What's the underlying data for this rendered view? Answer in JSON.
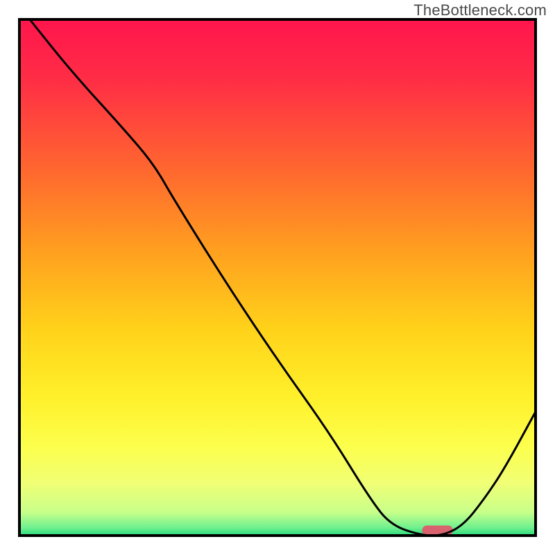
{
  "watermark": "TheBottleneck.com",
  "chart_data": {
    "type": "line",
    "title": "",
    "xlabel": "",
    "ylabel": "",
    "xlim": [
      0,
      100
    ],
    "ylim": [
      0,
      100
    ],
    "x": [
      2,
      10,
      20,
      26,
      30,
      40,
      50,
      60,
      68,
      72,
      78,
      82,
      86,
      90,
      94,
      100
    ],
    "y": [
      100,
      90,
      79,
      72,
      65,
      49,
      34,
      20,
      7,
      2,
      0,
      0,
      2,
      7,
      13,
      24
    ],
    "marker": {
      "x_start": 78,
      "x_end": 84,
      "y": 1.0
    },
    "gradient_stops": [
      {
        "pos": 0.0,
        "color": "#ff154d"
      },
      {
        "pos": 0.12,
        "color": "#ff2e45"
      },
      {
        "pos": 0.3,
        "color": "#ff6a2e"
      },
      {
        "pos": 0.45,
        "color": "#ffa01f"
      },
      {
        "pos": 0.6,
        "color": "#ffd21a"
      },
      {
        "pos": 0.73,
        "color": "#fff02a"
      },
      {
        "pos": 0.83,
        "color": "#fcff4d"
      },
      {
        "pos": 0.9,
        "color": "#f0ff76"
      },
      {
        "pos": 0.955,
        "color": "#c7ff8a"
      },
      {
        "pos": 0.985,
        "color": "#6ef08f"
      },
      {
        "pos": 1.0,
        "color": "#28d97a"
      }
    ],
    "marker_color": "#d9626f",
    "curve_color": "#000000",
    "border_color": "#000000"
  }
}
